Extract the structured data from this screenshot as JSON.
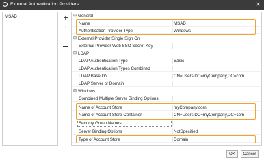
{
  "window": {
    "title": "External Authentication Providers",
    "close_glyph": "✕"
  },
  "providers": {
    "items": [
      {
        "label": "MSAD"
      }
    ]
  },
  "side_buttons": {
    "add": "+",
    "up": "↑",
    "down": "↓"
  },
  "grid": {
    "toggle_glyph": "⊟",
    "categories": [
      {
        "label": "General",
        "rows": [
          {
            "name": "Name",
            "value": "MSAD"
          },
          {
            "name": "Authentication Provider Type",
            "value": "Windows"
          }
        ]
      },
      {
        "label": "External Provider Single Sign On",
        "rows": [
          {
            "name": "External Provider Web SSO Secret Key",
            "value": ""
          }
        ]
      },
      {
        "label": "LDAP",
        "rows": [
          {
            "name": "LDAP Authentication Type",
            "value": "Basic"
          },
          {
            "name": "LDAP Authentication Types Combined",
            "value": ""
          },
          {
            "name": "LDAP Base DN",
            "value": "CN=Users,DC=myCompany,DC=com"
          },
          {
            "name": "LDAP Server or Domain",
            "value": ""
          }
        ]
      },
      {
        "label": "Windows",
        "rows": [
          {
            "name": "Combined Multiple Server Binding Options",
            "value": ""
          },
          {
            "name": "Name of Account Store",
            "value": "myCompany.com"
          },
          {
            "name": "Name of Account Store Container",
            "value": "CN=Users,DC=myCompany,DC=com"
          },
          {
            "name": "Security Group Names",
            "value": ""
          },
          {
            "name": "Server Binding Options",
            "value": "NotSpecified"
          },
          {
            "name": "Type of Account Store",
            "value": "Domain"
          }
        ]
      }
    ]
  },
  "footer": {
    "ok_label": "OK",
    "cancel_label": "Cancel"
  },
  "colors": {
    "titlebar": "#3b3b3b",
    "highlight": "#f0a232"
  }
}
